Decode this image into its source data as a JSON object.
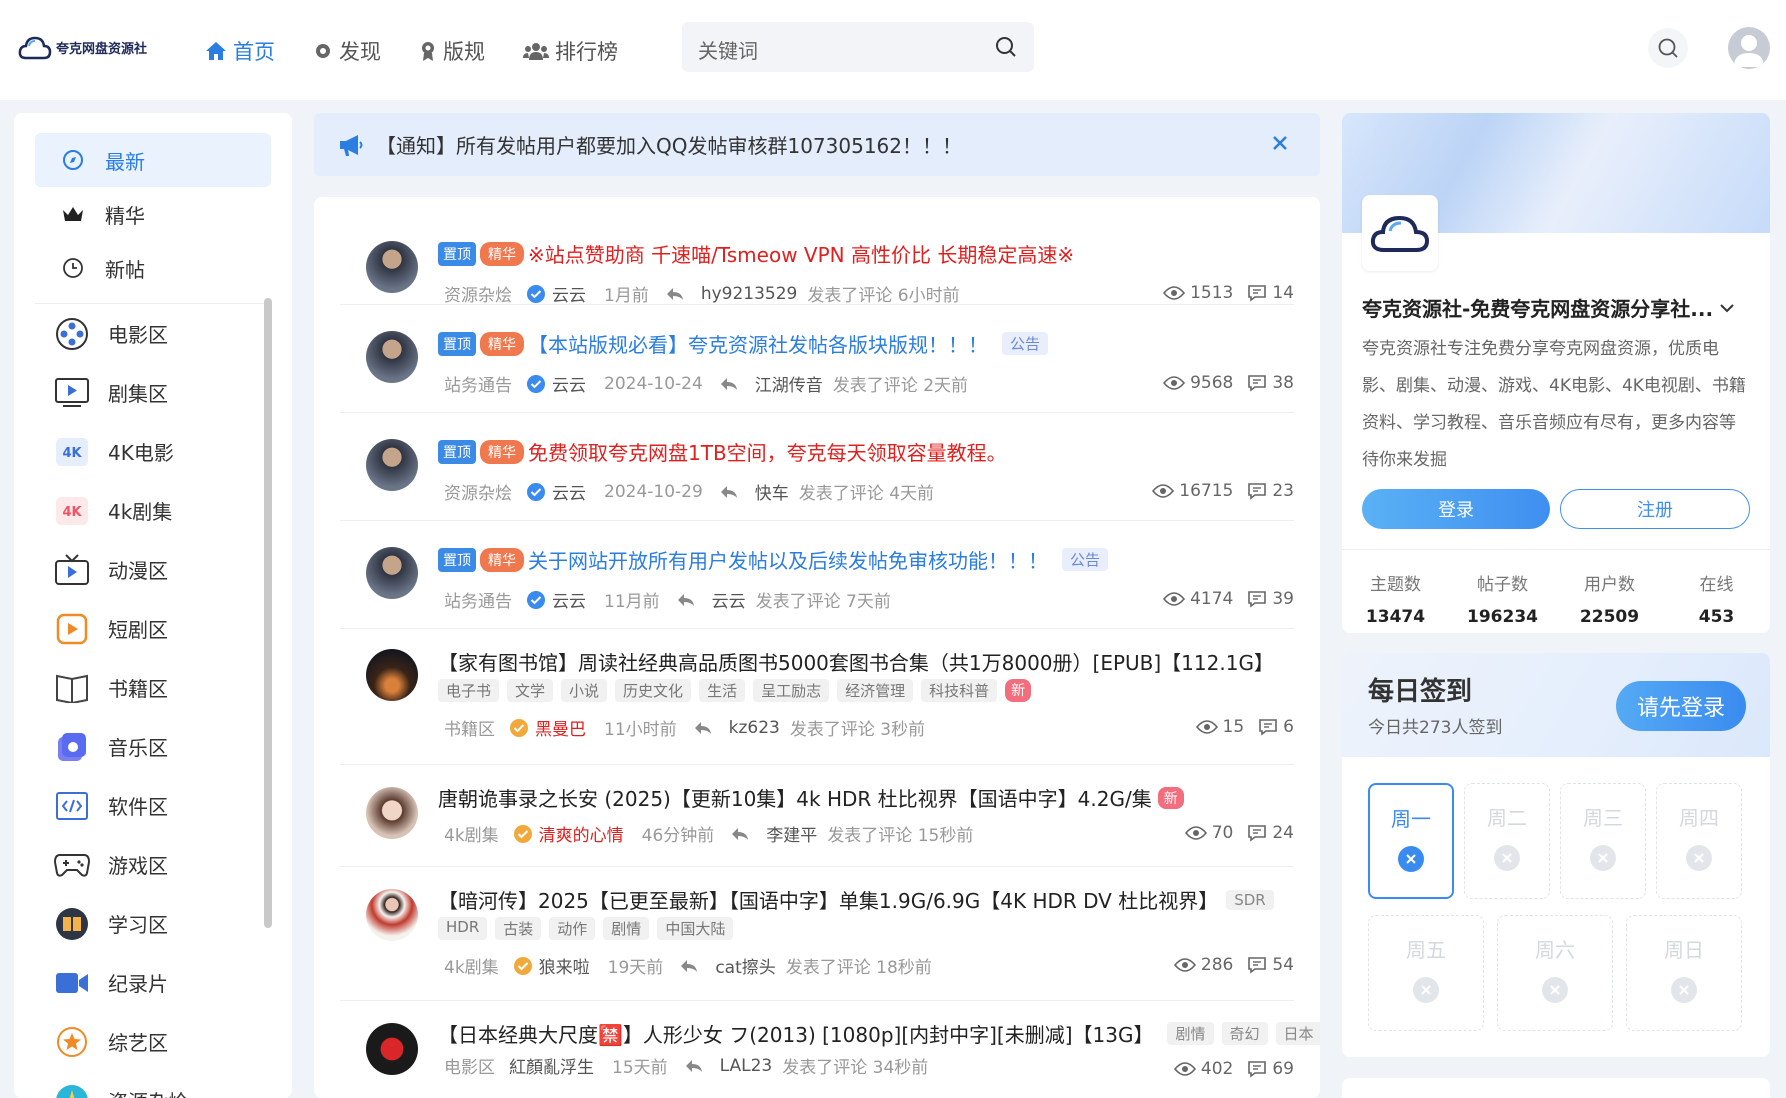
{
  "header": {
    "logo_text": "夸克网盘资源社",
    "nav": [
      {
        "label": "首页",
        "icon": "home-icon",
        "active": true
      },
      {
        "label": "发现",
        "icon": "compass-icon",
        "active": false
      },
      {
        "label": "版规",
        "icon": "rule-icon",
        "active": false
      },
      {
        "label": "排行榜",
        "icon": "users-icon",
        "active": false
      }
    ],
    "search_placeholder": "关键词"
  },
  "sidebar": {
    "top": [
      {
        "label": "最新",
        "icon": "compass-icon",
        "active": true
      },
      {
        "label": "精华",
        "icon": "crown-icon",
        "active": false
      },
      {
        "label": "新帖",
        "icon": "clock-icon",
        "active": false
      }
    ],
    "categories": [
      {
        "label": "电影区",
        "icon": "film-reel-icon"
      },
      {
        "label": "剧集区",
        "icon": "tv-play-icon"
      },
      {
        "label": "4K电影",
        "icon": "4k-icon"
      },
      {
        "label": "4k剧集",
        "icon": "4k-red-icon"
      },
      {
        "label": "动漫区",
        "icon": "tv-anime-icon"
      },
      {
        "label": "短剧区",
        "icon": "short-play-icon"
      },
      {
        "label": "书籍区",
        "icon": "book-icon"
      },
      {
        "label": "音乐区",
        "icon": "music-icon"
      },
      {
        "label": "软件区",
        "icon": "code-icon"
      },
      {
        "label": "游戏区",
        "icon": "gamepad-icon"
      },
      {
        "label": "学习区",
        "icon": "study-book-icon"
      },
      {
        "label": "纪录片",
        "icon": "video-camera-icon"
      },
      {
        "label": "综艺区",
        "icon": "star-icon"
      },
      {
        "label": "资源杂烩",
        "icon": "misc-icon"
      }
    ]
  },
  "notice": {
    "text": "【通知】所有发帖用户都要加入QQ发帖审核群107305162！！！"
  },
  "posts": [
    {
      "top": "置顶",
      "essence": "精华",
      "title": "※站点赞助商 千速喵/Tsmeow VPN 高性价比 长期稳定高速※",
      "title_color": "red",
      "category": "资源杂烩",
      "author": "云云",
      "time": "1月前",
      "replier": "hy9213529",
      "reply_text": "发表了评论 6小时前",
      "views": "1513",
      "comments": "14"
    },
    {
      "top": "置顶",
      "essence": "精华",
      "title": "【本站版规必看】夸克资源社发帖各版块版规！！！",
      "title_color": "blue",
      "tag": "公告",
      "category": "站务通告",
      "author": "云云",
      "time": "2024-10-24",
      "replier": "江湖传音",
      "reply_text": "发表了评论 2天前",
      "views": "9568",
      "comments": "38"
    },
    {
      "top": "置顶",
      "essence": "精华",
      "title": "免费领取夸克网盘1TB空间，夸克每天领取容量教程。",
      "title_color": "red",
      "category": "资源杂烩",
      "author": "云云",
      "time": "2024-10-29",
      "replier": "快车",
      "reply_text": "发表了评论 4天前",
      "views": "16715",
      "comments": "23"
    },
    {
      "top": "置顶",
      "essence": "精华",
      "title": "关于网站开放所有用户发帖以及后续发帖免审核功能！！！",
      "title_color": "blue",
      "tag": "公告",
      "category": "站务通告",
      "author": "云云",
      "time": "11月前",
      "replier": "云云",
      "reply_text": "发表了评论 7天前",
      "views": "4174",
      "comments": "39"
    },
    {
      "title": "【家有图书馆】周读社经典高品质图书5000套图书合集（共1万8000册）[EPUB]【112.1G】",
      "tags": [
        "电子书",
        "文学",
        "小说",
        "历史文化",
        "生活",
        "呈工励志",
        "经济管理",
        "科技科普"
      ],
      "new_badge": "新",
      "category": "书籍区",
      "author": "黑曼巴",
      "time": "11小时前",
      "replier": "kz623",
      "reply_text": "发表了评论 3秒前",
      "views": "15",
      "comments": "6"
    },
    {
      "title": "唐朝诡事录之长安 (2025)【更新10集】4k HDR 杜比视界【国语中字】4.2G/集",
      "new_badge": "新",
      "category": "4k剧集",
      "author": "清爽的心情",
      "time": "46分钟前",
      "replier": "李建平",
      "reply_text": "发表了评论 15秒前",
      "views": "70",
      "comments": "24"
    },
    {
      "title": "【暗河传】2025【已更至最新】【国语中字】单集1.9G/6.9G【4K HDR DV 杜比视界】",
      "tag": "SDR",
      "tags": [
        "HDR",
        "古装",
        "动作",
        "剧情",
        "中国大陆"
      ],
      "category": "4k剧集",
      "author": "狼来啦",
      "time": "19天前",
      "replier": "cat擦头",
      "reply_text": "发表了评论 18秒前",
      "views": "286",
      "comments": "54"
    },
    {
      "title": "【日本经典大尺度🈲】人形少女 フ(2013) [1080p][内封中字][未删减]【13G】",
      "tags_inline": [
        "剧情",
        "奇幻",
        "日本"
      ],
      "category": "电影区",
      "author": "紅顏亂浮生",
      "time": "15天前",
      "replier": "LAL23",
      "reply_text": "发表了评论 34秒前",
      "views": "402",
      "comments": "69"
    }
  ],
  "profile": {
    "title": "夸克资源社-免费夸克网盘资源分享社...",
    "desc": "夸克资源社专注免费分享夸克网盘资源，优质电影、剧集、动漫、游戏、4K电影、4K电视剧、书籍资料、学习教程、音乐音频应有尽有，更多内容等待你来发掘",
    "login": "登录",
    "register": "注册",
    "stats": [
      {
        "label": "主题数",
        "value": "13474"
      },
      {
        "label": "帖子数",
        "value": "196234"
      },
      {
        "label": "用户数",
        "value": "22509"
      },
      {
        "label": "在线",
        "value": "453"
      }
    ]
  },
  "signin": {
    "title": "每日签到",
    "sub": "今日共273人签到",
    "button": "请先登录",
    "days": [
      "周一",
      "周二",
      "周三",
      "周四",
      "周五",
      "周六",
      "周日"
    ]
  },
  "colors": {
    "accent": "#2a7de1",
    "red": "#e0201f",
    "bg": "#f0f4f9"
  }
}
